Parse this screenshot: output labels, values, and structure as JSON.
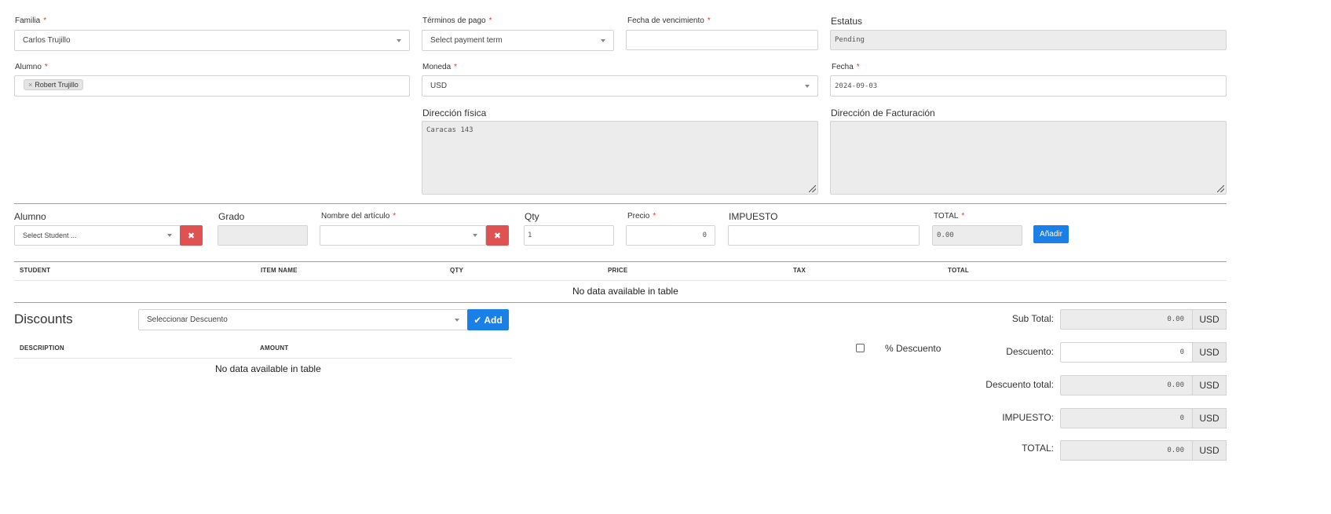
{
  "form": {
    "familia": {
      "label": "Familia",
      "value": "Carlos Trujillo"
    },
    "terminos": {
      "label": "Términos de pago",
      "placeholder": "Select payment term"
    },
    "vencimiento": {
      "label": "Fecha de vencimiento",
      "value": ""
    },
    "estatus": {
      "label": "Estatus",
      "value": "Pending"
    },
    "alumno": {
      "label": "Alumno",
      "tag": "Robert Trujillo",
      "tag_remove": "×"
    },
    "moneda": {
      "label": "Moneda",
      "value": "USD"
    },
    "fecha": {
      "label": "Fecha",
      "value": "2024-09-03"
    },
    "dir_fisica": {
      "label": "Dirección física",
      "value": "Caracas 143"
    },
    "dir_facturacion": {
      "label": "Dirección de Facturación",
      "value": ""
    },
    "required_mark": "*"
  },
  "item_row": {
    "alumno": {
      "label": "Alumno",
      "placeholder": "Select Student ..."
    },
    "grado": {
      "label": "Grado",
      "value": ""
    },
    "articulo": {
      "label": "Nombre del artículo",
      "value": ""
    },
    "qty": {
      "label": "Qty",
      "value": "1"
    },
    "precio": {
      "label": "Precio",
      "value": "0"
    },
    "impuesto": {
      "label": "IMPUESTO",
      "value": ""
    },
    "total": {
      "label": "TOTAL",
      "value": "0.00"
    },
    "clear_glyph": "✖",
    "add_label": "Añadir"
  },
  "items_table": {
    "headers": [
      "STUDENT",
      "ITEM NAME",
      "QTY",
      "PRICE",
      "TAX",
      "TOTAL"
    ],
    "empty": "No data available in table"
  },
  "discounts": {
    "title": "Discounts",
    "select_placeholder": "Seleccionar Descuento",
    "add_label": "Add",
    "add_icon": "✔",
    "headers": [
      "DESCRIPTION",
      "AMOUNT"
    ],
    "empty": "No data available in table"
  },
  "summary": {
    "pct_label": "% Descuento",
    "pct_checked": false,
    "currency": "USD",
    "rows": [
      {
        "label": "Sub Total:",
        "value": "0.00"
      },
      {
        "label": "Descuento:",
        "value": "0"
      },
      {
        "label": "Descuento total:",
        "value": "0.00"
      },
      {
        "label": "IMPUESTO:",
        "value": "0"
      },
      {
        "label": "TOTAL:",
        "value": "0.00"
      }
    ]
  },
  "colors": {
    "accent": "#1a7fe6",
    "danger": "#e05252",
    "required": "#e53935"
  }
}
